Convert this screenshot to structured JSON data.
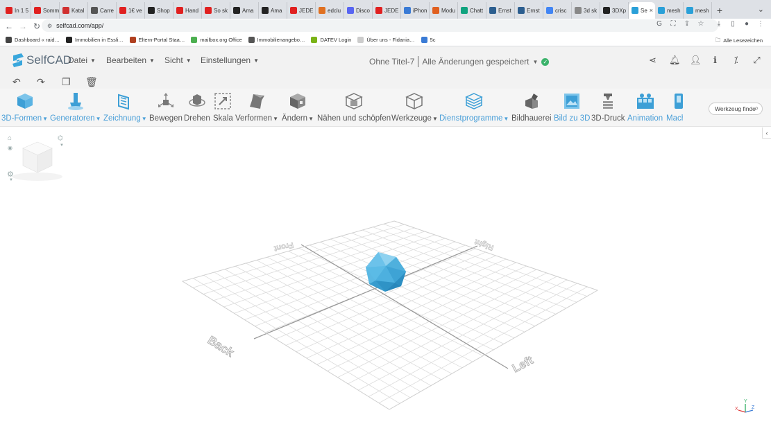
{
  "browser": {
    "tabs": [
      {
        "title": "In 1 5",
        "color": "#e02020"
      },
      {
        "title": "Somm",
        "color": "#e02020"
      },
      {
        "title": "Katal",
        "color": "#d03030"
      },
      {
        "title": "Carre",
        "color": "#555555"
      },
      {
        "title": "1€ ve",
        "color": "#e02020"
      },
      {
        "title": "Shop",
        "color": "#222222"
      },
      {
        "title": "Hand",
        "color": "#e02020"
      },
      {
        "title": "So sk",
        "color": "#e02020"
      },
      {
        "title": "Ama",
        "color": "#222222"
      },
      {
        "title": "Ama",
        "color": "#222222"
      },
      {
        "title": "JEDE",
        "color": "#e02020"
      },
      {
        "title": "edclu",
        "color": "#e07020"
      },
      {
        "title": "Disco",
        "color": "#5865f2"
      },
      {
        "title": "JEDE",
        "color": "#e02020"
      },
      {
        "title": "iPhon",
        "color": "#3a7bd5"
      },
      {
        "title": "Modu",
        "color": "#e06020"
      },
      {
        "title": "Chatt",
        "color": "#10a37f"
      },
      {
        "title": "Ernst",
        "color": "#2c5e8f"
      },
      {
        "title": "Ernst",
        "color": "#2c5e8f"
      },
      {
        "title": "crisc",
        "color": "#4285f4"
      },
      {
        "title": "3d sk",
        "color": "#888888"
      },
      {
        "title": "3DXp",
        "color": "#222222"
      },
      {
        "title": "Se",
        "color": "#2aa0d8",
        "active": true
      },
      {
        "title": "mesh",
        "color": "#2aa0d8"
      },
      {
        "title": "mesh",
        "color": "#2aa0d8"
      }
    ],
    "new_tab": "+",
    "url": "selfcad.com/app/",
    "bookmarks": [
      {
        "label": "Dashboard « raid…",
        "color": "#444444"
      },
      {
        "label": "Immobilien in Essli…",
        "color": "#222222"
      },
      {
        "label": "Eltern-Portal Staa…",
        "color": "#b04020"
      },
      {
        "label": "mailbox.org Office",
        "color": "#4caf50"
      },
      {
        "label": "Immobilienangebo…",
        "color": "#555555"
      },
      {
        "label": "DATEV Login",
        "color": "#7ab317"
      },
      {
        "label": "Über uns - Fidania…",
        "color": "#cccccc"
      },
      {
        "label": "5c",
        "color": "#3a7bd5"
      }
    ],
    "all_bookmarks": "Alle Lesezeichen"
  },
  "app": {
    "logo_text": "SelfCAD",
    "menus": [
      "Datei",
      "Bearbeiten",
      "Sicht",
      "Einstellungen"
    ],
    "document_title": "Ohne Titel-7",
    "save_status": "Alle Änderungen gespeichert",
    "tools": [
      {
        "label": "3D-Formen",
        "blue": true,
        "caret": true
      },
      {
        "label": "Generatoren",
        "blue": true,
        "caret": true
      },
      {
        "label": "Zeichnung",
        "blue": true,
        "caret": true
      },
      {
        "label": "Bewegen",
        "blue": false,
        "caret": false
      },
      {
        "label": "Drehen",
        "blue": false,
        "caret": false
      },
      {
        "label": "Skala",
        "blue": false,
        "caret": false
      },
      {
        "label": "Verformen",
        "blue": false,
        "caret": true
      },
      {
        "label": "Ändern",
        "blue": false,
        "caret": true
      },
      {
        "label": "Nähen und schöpfen",
        "blue": false,
        "caret": false
      },
      {
        "label": "Werkzeuge",
        "blue": false,
        "caret": true
      },
      {
        "label": "Dienstprogramme",
        "blue": true,
        "caret": true
      },
      {
        "label": "Bildhauerei",
        "blue": false,
        "caret": false
      },
      {
        "label": "Bild zu 3D",
        "blue": true,
        "caret": false
      },
      {
        "label": "3D-Druck",
        "blue": false,
        "caret": false
      },
      {
        "label": "Animation",
        "blue": true,
        "caret": false
      },
      {
        "label": "Mach",
        "blue": true,
        "caret": false
      }
    ],
    "tool_search_value": "Werkzeug finde",
    "grid_labels": {
      "front": "Front",
      "right": "Right",
      "back": "Back",
      "left": "Left"
    },
    "axes": {
      "x": "X",
      "y": "Y",
      "z": "Z"
    }
  }
}
